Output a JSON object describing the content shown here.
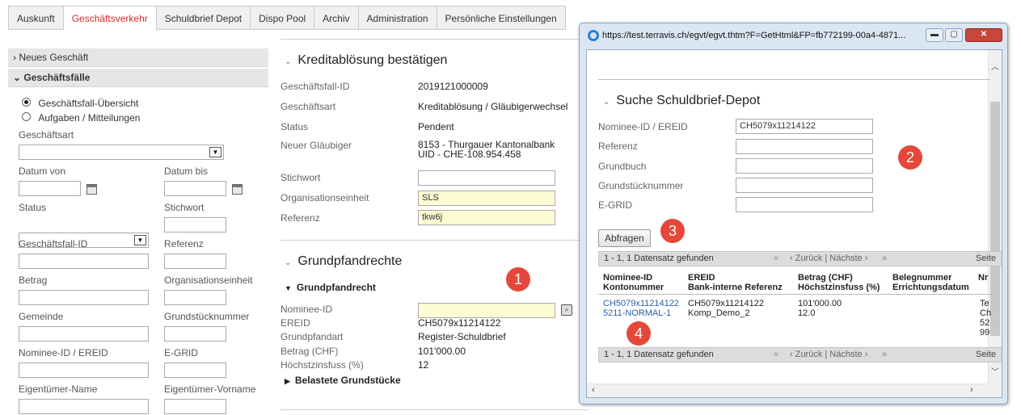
{
  "tabs": [
    "Auskunft",
    "Geschäftsverkehr",
    "Schuldbrief Depot",
    "Dispo Pool",
    "Archiv",
    "Administration",
    "Persönliche Einstellungen"
  ],
  "sidebar": {
    "neues_geschaeft": "Neues Geschäft",
    "geschaeftsfaelle": "Geschäftsfälle",
    "radio_uebersicht": "Geschäftsfall-Übersicht",
    "radio_aufgaben": "Aufgaben / Mitteilungen",
    "geschaeftsart": "Geschäftsart",
    "datum_von": "Datum von",
    "datum_bis": "Datum bis",
    "status": "Status",
    "stichwort": "Stichwort",
    "geschaeftsfall_id": "Geschäftsfall-ID",
    "referenz": "Referenz",
    "betrag": "Betrag",
    "organisationseinheit": "Organisationseinheit",
    "gemeinde": "Gemeinde",
    "grundstuecknummer": "Grundstücknummer",
    "nominee_ereid": "Nominee-ID / EREID",
    "egrid": "E-GRID",
    "eigentuemer_name": "Eigentümer-Name",
    "eigentuemer_vorname": "Eigentümer-Vorname"
  },
  "main": {
    "title": "Kreditablösung bestätigen",
    "fields": {
      "id_label": "Geschäftsfall-ID",
      "id_value": "2019121000009",
      "art_label": "Geschäftsart",
      "art_value": "Kreditablösung / Gläubigerwechsel",
      "status_label": "Status",
      "status_value": "Pendent",
      "glaeubiger_label": "Neuer Gläubiger",
      "glaeubiger_line1": "8153 - Thurgauer Kantonalbank",
      "glaeubiger_line2": "UID - CHE-108.954.458",
      "stichwort_label": "Stichwort",
      "org_label": "Organisationseinheit",
      "org_value": "SLS",
      "referenz_label": "Referenz",
      "referenz_value": "tkw6j"
    },
    "grund_title": "Grundpfandrechte",
    "grund_sub": "Grundpfandrecht",
    "grund": {
      "nominee_label": "Nominee-ID",
      "ereid_label": "EREID",
      "ereid_value": "CH5079x11214122",
      "art_label": "Grundpfandart",
      "art_value": "Register-Schuldbrief",
      "betrag_label": "Betrag (CHF)",
      "betrag_value": "101'000.00",
      "zins_label": "Höchstzinsfuss (%)",
      "zins_value": "12",
      "belastete": "Belastete Grundstücke"
    }
  },
  "popup": {
    "url": "https://test.terravis.ch/egvt/egvt.thtm?F=GetHtml&FP=fb772199-00a4-4871...",
    "title": "Suche Schuldbrief-Depot",
    "fields": {
      "nominee_label": "Nominee-ID / EREID",
      "nominee_value": "CH5079x11214122",
      "referenz_label": "Referenz",
      "grundbuch_label": "Grundbuch",
      "gsnr_label": "Grundstücknummer",
      "egrid_label": "E-GRID"
    },
    "abfragen": "Abfragen",
    "pager_count": "1 - 1, 1 Datensatz gefunden",
    "pager_first": "«",
    "pager_nav": "‹ Zurück  |  Nächste ›",
    "pager_last": "»",
    "pager_seite": "Seite",
    "headers": {
      "h1a": "Nominee-ID",
      "h1b": "Kontonummer",
      "h2a": "EREID",
      "h2b": "Bank-interne Referenz",
      "h3a": "Betrag (CHF)",
      "h3b": "Höchstzinsfuss (%)",
      "h4a": "Belegnummer",
      "h4b": "Errichtungsdatum",
      "h5": "Nr"
    },
    "row": {
      "c1a": "CH5079x11214122",
      "c1b": "5211-NORMAL-1",
      "c2a": "CH5079x11214122",
      "c2b": "Komp_Demo_2",
      "c3a": "101'000.00",
      "c3b": "12.0",
      "c5a": "Te",
      "c5b": "Ch",
      "c5c": "52",
      "c5d": "99"
    }
  },
  "markers": [
    "1",
    "2",
    "3",
    "4"
  ]
}
